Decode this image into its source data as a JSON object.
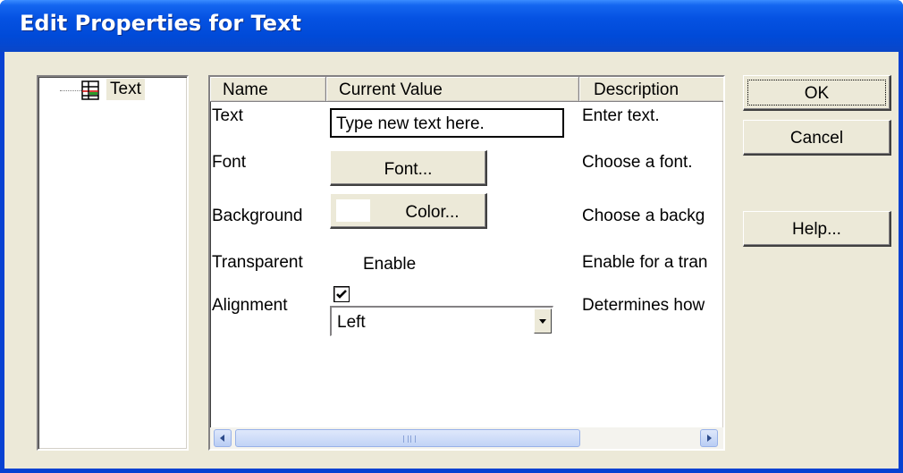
{
  "window": {
    "title": "Edit Properties for Text"
  },
  "tree": {
    "items": [
      {
        "label": "Text",
        "icon": "table-grid-icon"
      }
    ]
  },
  "grid": {
    "headers": [
      "Name",
      "Current Value",
      "Description"
    ],
    "rows": [
      {
        "name": "Text",
        "value": "Type new text here.",
        "description": "Enter text."
      },
      {
        "name": "Font",
        "value": "Font...",
        "description": "Choose a font."
      },
      {
        "name": "Background",
        "value": "Color...",
        "description": "Choose a backg"
      },
      {
        "name": "Transparent",
        "value": "Enable",
        "description": "Enable for a tran"
      },
      {
        "name": "Alignment",
        "value": "Left",
        "description": "Determines how"
      }
    ],
    "transparent_checked": true
  },
  "buttons": {
    "ok": "OK",
    "cancel": "Cancel",
    "help": "Help..."
  },
  "colors": {
    "titlebar": "#0a57e0",
    "dialog_bg": "#ece9d8",
    "background_swatch": "#ffffff"
  }
}
